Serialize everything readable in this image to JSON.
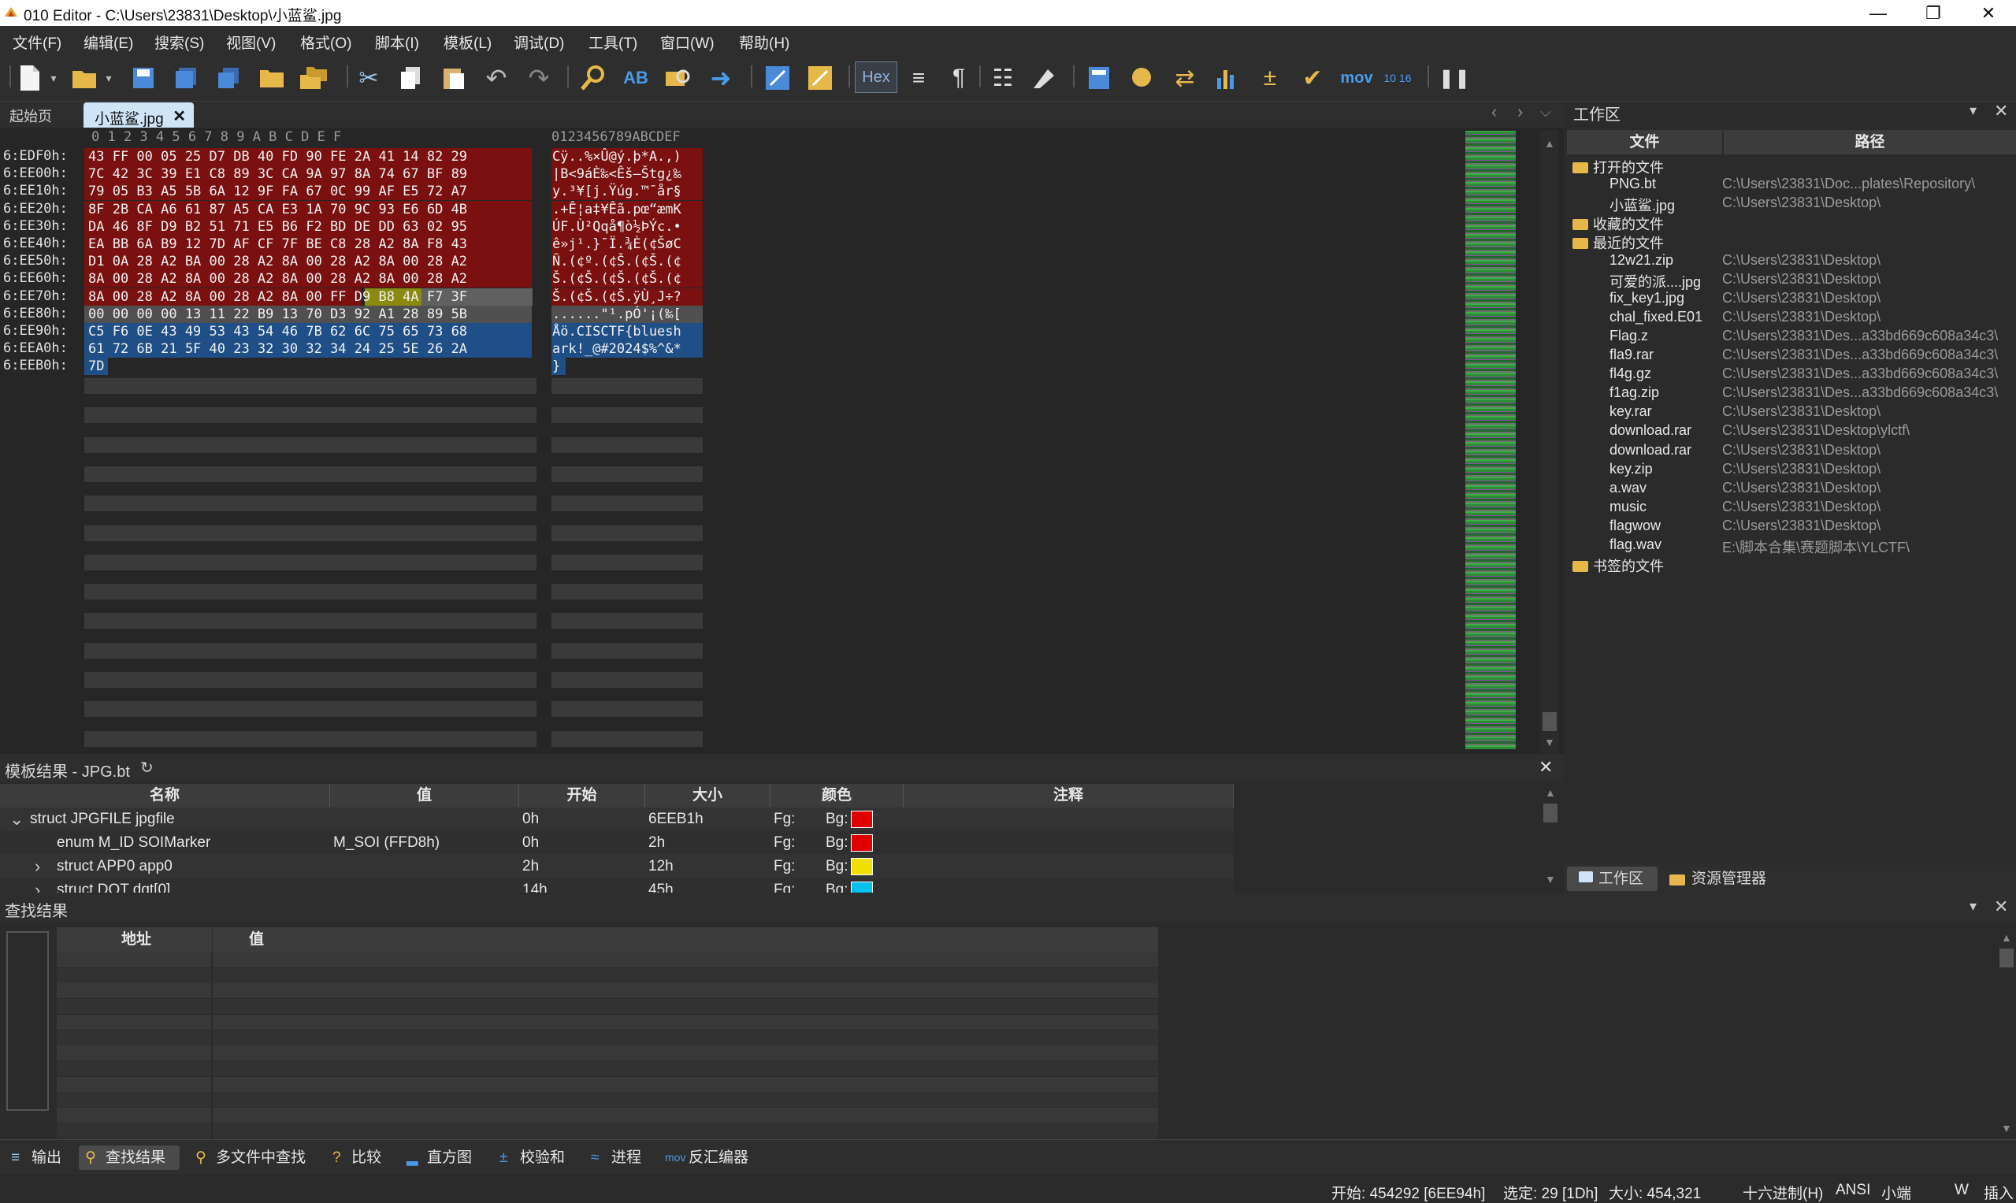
{
  "window": {
    "title": "010 Editor - C:\\Users\\23831\\Desktop\\小蓝鲨.jpg"
  },
  "menu": [
    "文件(F)",
    "编辑(E)",
    "搜索(S)",
    "视图(V)",
    "格式(O)",
    "脚本(I)",
    "模板(L)",
    "调试(D)",
    "工具(T)",
    "窗口(W)",
    "帮助(H)"
  ],
  "toolbar": {
    "hex_label": "Hex",
    "mov_label": "mov",
    "base_label": "10 16"
  },
  "tabs": {
    "start": "起始页",
    "file": "小蓝鲨.jpg"
  },
  "hex": {
    "col_header": "0  1  2  3  4  5  6  7  8  9  A  B  C  D  E  F",
    "ascii_header": "0123456789ABCDEF",
    "rows": [
      {
        "addr": "6:EDF0h:",
        "hex": "43 FF 00 05 25 D7 DB 40 FD 90 FE 2A 41 14 82 29",
        "ascii": "Cÿ..%×Û@ý.þ*A.,)"
      },
      {
        "addr": "6:EE00h:",
        "hex": "7C 42 3C 39 E1 C8 89 3C CA 9A 97 8A 74 67 BF 89",
        "ascii": "|B<9áÈ‰<Êš—Štg¿‰"
      },
      {
        "addr": "6:EE10h:",
        "hex": "79 05 B3 A5 5B 6A 12 9F FA 67 0C 99 AF E5 72 A7",
        "ascii": "y.³¥[j.Ÿúg.™¯år§"
      },
      {
        "addr": "6:EE20h:",
        "hex": "8F 2B CA A6 61 87 A5 CA E3 1A 70 9C 93 E6 6D 4B",
        "ascii": ".+Ê¦a‡¥Êã.pœ“æmK"
      },
      {
        "addr": "6:EE30h:",
        "hex": "DA 46 8F D9 B2 51 71 E5 B6 F2 BD DE DD 63 02 95",
        "ascii": "ÚF.Ù²Qqå¶ò½ÞÝc.•"
      },
      {
        "addr": "6:EE40h:",
        "hex": "EA BB 6A B9 12 7D AF CF 7F BE C8 28 A2 8A F8 43",
        "ascii": "ê»j¹.}¯Ï.¾È(¢ŠøC"
      },
      {
        "addr": "6:EE50h:",
        "hex": "D1 0A 28 A2 BA 00 28 A2 8A 00 28 A2 8A 00 28 A2",
        "ascii": "Ñ.(¢º.(¢Š.(¢Š.(¢"
      },
      {
        "addr": "6:EE60h:",
        "hex": "8A 00 28 A2 8A 00 28 A2 8A 00 28 A2 8A 00 28 A2",
        "ascii": "Š.(¢Š.(¢Š.(¢Š.(¢"
      },
      {
        "addr": "6:EE70h:",
        "hex": "8A 00 28 A2 8A 00 28 A2 8A 00 FF D9 B8 4A F7 3F",
        "ascii": "Š.(¢Š.(¢Š.ÿÙ¸J÷?"
      },
      {
        "addr": "6:EE80h:",
        "hex": "00 00 00 00 13 11 22 B9 13 70 D3 92 A1 28 89 5B",
        "ascii": "......\"¹.pÓ'¡(‰["
      },
      {
        "addr": "6:EE90h:",
        "hex": "C5 F6 0E 43 49 53 43 54 46 7B 62 6C 75 65 73 68",
        "ascii": "Åö.CISCTF{bluesh"
      },
      {
        "addr": "6:EEA0h:",
        "hex": "61 72 6B 21 5F 40 23 32 30 32 34 24 25 5E 26 2A",
        "ascii": "ark!_@#2024$%^&*"
      },
      {
        "addr": "6:EEB0h:",
        "hex": "7D",
        "ascii": "}"
      }
    ]
  },
  "workspace": {
    "title": "工作区",
    "col_file": "文件",
    "col_path": "路径",
    "groups": {
      "open": "打开的文件",
      "fav": "收藏的文件",
      "recent": "最近的文件",
      "bookmark": "书签的文件"
    },
    "open_files": [
      {
        "name": "PNG.bt",
        "path": "C:\\Users\\23831\\Doc...plates\\Repository\\"
      },
      {
        "name": "小蓝鲨.jpg",
        "path": "C:\\Users\\23831\\Desktop\\"
      }
    ],
    "recent_files": [
      {
        "name": "12w21.zip",
        "path": "C:\\Users\\23831\\Desktop\\"
      },
      {
        "name": "可爱的派....jpg",
        "path": "C:\\Users\\23831\\Desktop\\"
      },
      {
        "name": "fix_key1.jpg",
        "path": "C:\\Users\\23831\\Desktop\\"
      },
      {
        "name": "chal_fixed.E01",
        "path": "C:\\Users\\23831\\Desktop\\"
      },
      {
        "name": "Flag.z",
        "path": "C:\\Users\\23831\\Des...a33bd669c608a34c3\\"
      },
      {
        "name": "fla9.rar",
        "path": "C:\\Users\\23831\\Des...a33bd669c608a34c3\\"
      },
      {
        "name": "fl4g.gz",
        "path": "C:\\Users\\23831\\Des...a33bd669c608a34c3\\"
      },
      {
        "name": "f1ag.zip",
        "path": "C:\\Users\\23831\\Des...a33bd669c608a34c3\\"
      },
      {
        "name": "key.rar",
        "path": "C:\\Users\\23831\\Desktop\\"
      },
      {
        "name": "download.rar",
        "path": "C:\\Users\\23831\\Desktop\\ylctf\\"
      },
      {
        "name": "download.rar",
        "path": "C:\\Users\\23831\\Desktop\\"
      },
      {
        "name": "key.zip",
        "path": "C:\\Users\\23831\\Desktop\\"
      },
      {
        "name": "a.wav",
        "path": "C:\\Users\\23831\\Desktop\\"
      },
      {
        "name": "music",
        "path": "C:\\Users\\23831\\Desktop\\"
      },
      {
        "name": "flagwow",
        "path": "C:\\Users\\23831\\Desktop\\"
      },
      {
        "name": "flag.wav",
        "path": "E:\\脚本合集\\赛题脚本\\YLCTF\\"
      }
    ],
    "tab_workspace": "工作区",
    "tab_explorer": "资源管理器"
  },
  "template": {
    "title": "模板结果 - JPG.bt",
    "cols": [
      "名称",
      "值",
      "开始",
      "大小",
      "颜色",
      "注释"
    ],
    "rows": [
      {
        "name": "struct JPGFILE jpgfile",
        "value": "",
        "start": "0h",
        "size": "6EEB1h",
        "fg": "Fg:",
        "bg": "Bg:",
        "color": "#e00000"
      },
      {
        "name": "enum M_ID SOIMarker",
        "value": "M_SOI (FFD8h)",
        "start": "0h",
        "size": "2h",
        "fg": "Fg:",
        "bg": "Bg:",
        "color": "#e00000"
      },
      {
        "name": "struct APP0 app0",
        "value": "",
        "start": "2h",
        "size": "12h",
        "fg": "Fg:",
        "bg": "Bg:",
        "color": "#f0e000"
      },
      {
        "name": "struct DQT dqt[0]",
        "value": "",
        "start": "14h",
        "size": "45h",
        "fg": "Fg:",
        "bg": "Bg:",
        "color": "#00c0f0"
      }
    ]
  },
  "find": {
    "title": "查找结果",
    "col_addr": "地址",
    "col_value": "值"
  },
  "bottom_tabs": [
    "输出",
    "查找结果",
    "多文件中查找",
    "比较",
    "直方图",
    "校验和",
    "进程",
    "反汇编器"
  ],
  "status": {
    "start": "开始: 454292 [6EE94h]",
    "selected": "选定: 29 [1Dh]",
    "size": "大小: 454,321",
    "mode": "十六进制(H)",
    "encoding": "ANSI",
    "endian": "小端",
    "w": "W",
    "insert": "插入"
  }
}
